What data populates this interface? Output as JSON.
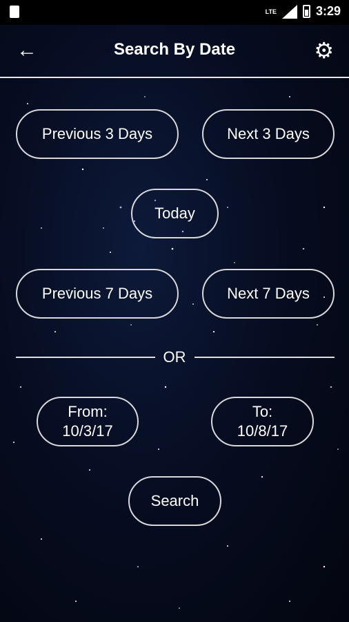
{
  "status_bar": {
    "time": "3:29",
    "network": "LTE"
  },
  "app_bar": {
    "title": "Search By Date",
    "back_icon": "arrow-left-icon",
    "settings_icon": "gear-icon"
  },
  "quick_ranges": {
    "previous_3": "Previous 3 Days",
    "next_3": "Next 3 Days",
    "today": "Today",
    "previous_7": "Previous 7 Days",
    "next_7": "Next 7 Days"
  },
  "separator": {
    "label": "OR"
  },
  "date_range": {
    "from_label": "From:",
    "from_value": "10/3/17",
    "to_label": "To:",
    "to_value": "10/8/17"
  },
  "search_label": "Search",
  "colors": {
    "background": "#070d22",
    "border": "#d9d9d9",
    "text": "#ffffff"
  }
}
